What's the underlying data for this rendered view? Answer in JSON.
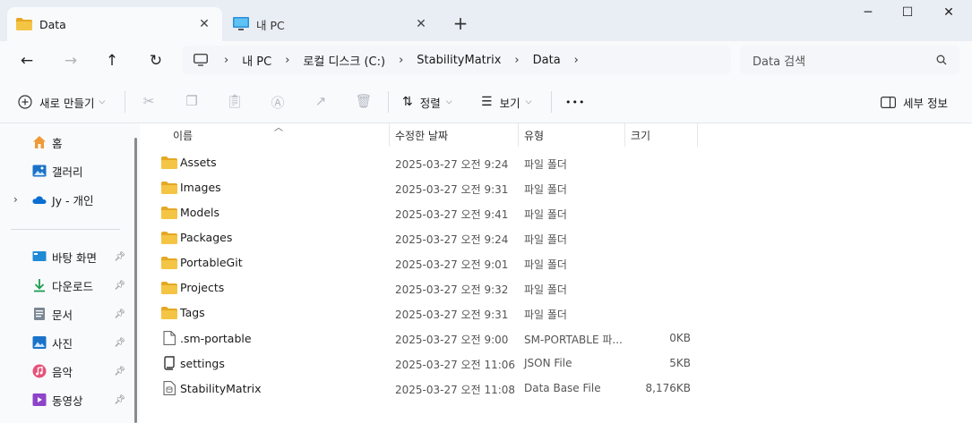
{
  "tabs": [
    {
      "label": "Data",
      "icon": "folder-icon"
    },
    {
      "label": "내 PC",
      "icon": "computer-icon"
    }
  ],
  "breadcrumb": [
    "내 PC",
    "로컬 디스크 (C:)",
    "StabilityMatrix",
    "Data"
  ],
  "search": {
    "placeholder": "Data 검색"
  },
  "toolbar": {
    "new_label": "새로 만들기",
    "sort_label": "정렬",
    "view_label": "보기",
    "more_label": "•••",
    "details_label": "세부 정보"
  },
  "sidebar": {
    "top": [
      {
        "label": "홈",
        "icon": "home-icon"
      },
      {
        "label": "갤러리",
        "icon": "gallery-icon"
      },
      {
        "label": "Jy - 개인",
        "icon": "onedrive-cloud-icon"
      }
    ],
    "quick": [
      {
        "label": "바탕 화면",
        "icon": "desktop-icon"
      },
      {
        "label": "다운로드",
        "icon": "download-icon"
      },
      {
        "label": "문서",
        "icon": "documents-icon"
      },
      {
        "label": "사진",
        "icon": "pictures-icon"
      },
      {
        "label": "음악",
        "icon": "music-icon"
      },
      {
        "label": "동영상",
        "icon": "videos-icon"
      }
    ]
  },
  "columns": [
    "이름",
    "수정한 날짜",
    "유형",
    "크기"
  ],
  "files": [
    {
      "name": "Assets",
      "date": "2025-03-27 오전 9:24",
      "type": "파일 폴더",
      "size": "",
      "icon": "folder-icon"
    },
    {
      "name": "Images",
      "date": "2025-03-27 오전 9:31",
      "type": "파일 폴더",
      "size": "",
      "icon": "folder-icon"
    },
    {
      "name": "Models",
      "date": "2025-03-27 오전 9:41",
      "type": "파일 폴더",
      "size": "",
      "icon": "folder-icon"
    },
    {
      "name": "Packages",
      "date": "2025-03-27 오전 9:24",
      "type": "파일 폴더",
      "size": "",
      "icon": "folder-icon"
    },
    {
      "name": "PortableGit",
      "date": "2025-03-27 오전 9:01",
      "type": "파일 폴더",
      "size": "",
      "icon": "folder-icon"
    },
    {
      "name": "Projects",
      "date": "2025-03-27 오전 9:32",
      "type": "파일 폴더",
      "size": "",
      "icon": "folder-icon"
    },
    {
      "name": "Tags",
      "date": "2025-03-27 오전 9:31",
      "type": "파일 폴더",
      "size": "",
      "icon": "folder-icon"
    },
    {
      "name": ".sm-portable",
      "date": "2025-03-27 오전 9:00",
      "type": "SM-PORTABLE 파...",
      "size": "0KB",
      "icon": "blank-file-icon"
    },
    {
      "name": "settings",
      "date": "2025-03-27 오전 11:06",
      "type": "JSON File",
      "size": "5KB",
      "icon": "json-file-icon"
    },
    {
      "name": "StabilityMatrix",
      "date": "2025-03-27 오전 11:08",
      "type": "Data Base File",
      "size": "8,176KB",
      "icon": "database-file-icon"
    }
  ],
  "colors": {
    "folder": "#f4c545",
    "folder_dark": "#e5a823",
    "accent": "#0067c0"
  }
}
